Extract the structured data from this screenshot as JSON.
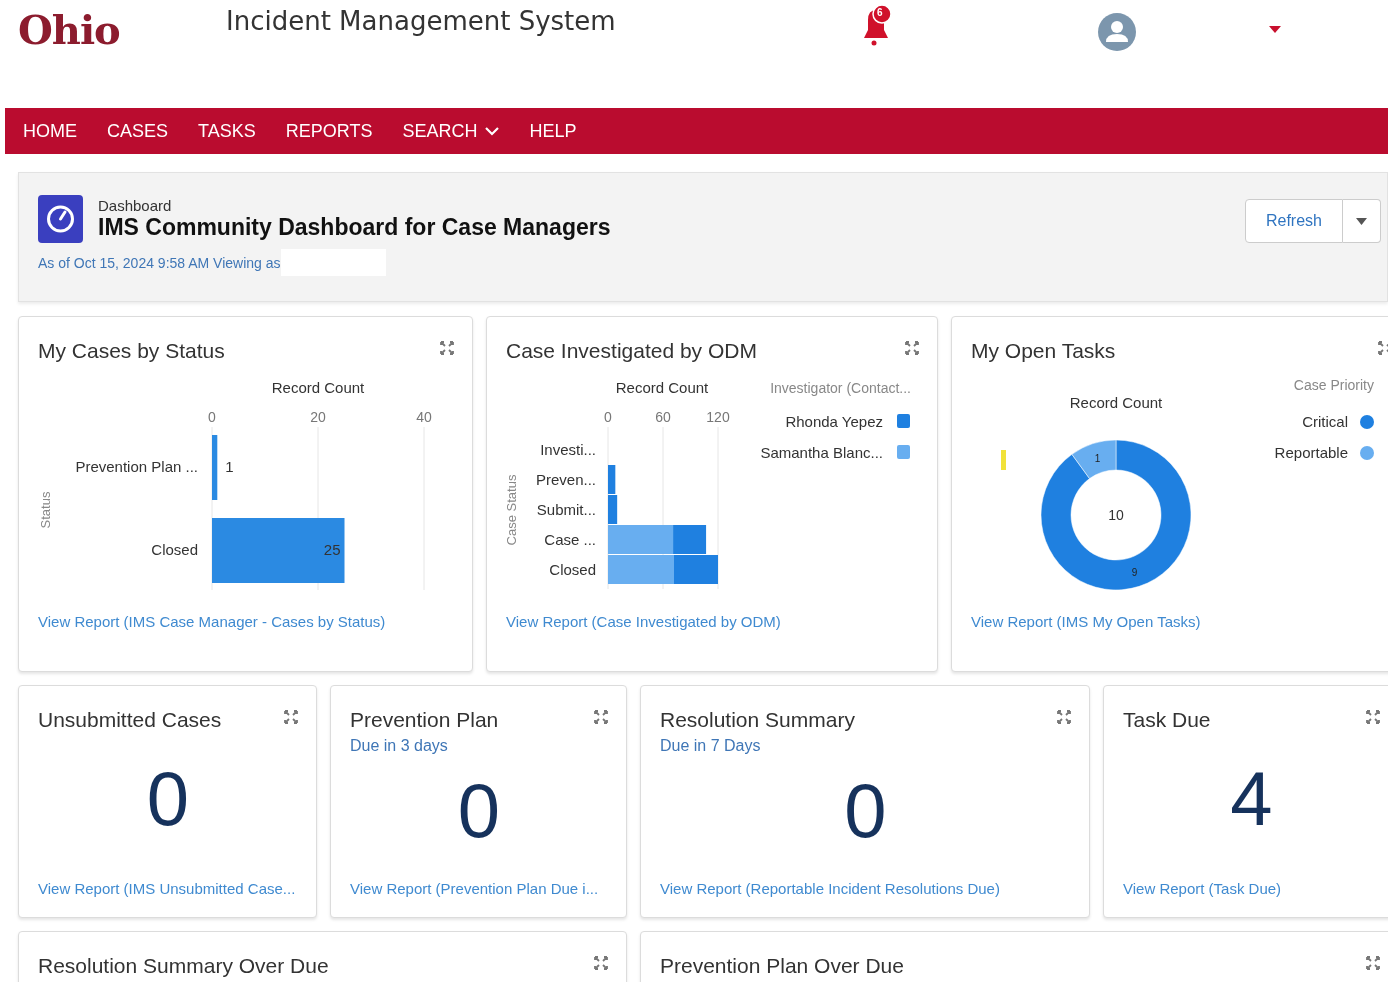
{
  "header": {
    "logo": "Ohio",
    "title": "Incident Management System",
    "notification_count": "6"
  },
  "nav": [
    {
      "label": "HOME",
      "has_menu": false
    },
    {
      "label": "CASES",
      "has_menu": false
    },
    {
      "label": "TASKS",
      "has_menu": false
    },
    {
      "label": "REPORTS",
      "has_menu": false
    },
    {
      "label": "SEARCH",
      "has_menu": true
    },
    {
      "label": "HELP",
      "has_menu": false
    }
  ],
  "dashboard": {
    "kicker": "Dashboard",
    "title": "IMS Community Dashboard for Case Managers",
    "as_of": "As of Oct 15, 2024 9:58 AM Viewing as",
    "refresh": "Refresh"
  },
  "rows": [
    {
      "cards": [
        {
          "kind": "bar",
          "title": "My Cases by Status",
          "link": "View Report (IMS Case Manager - Cases by Status)",
          "chart_data": {
            "type": "bar",
            "orientation": "horizontal",
            "xlabel": "Record Count",
            "ylabel": "Status",
            "categories": [
              "Prevention Plan ...",
              "Closed"
            ],
            "values": [
              1,
              25
            ],
            "xlim": [
              0,
              40
            ],
            "xticks": [
              0,
              20,
              40
            ],
            "data_labels": true
          }
        },
        {
          "kind": "stacked_bar",
          "title": "Case Investigated by ODM",
          "link": "View Report (Case Investigated by ODM)",
          "chart_data": {
            "type": "bar",
            "orientation": "horizontal",
            "stacked": true,
            "legend": {
              "title": "Investigator (Contact..."
            },
            "xlabel": "Record Count",
            "ylabel": "Case Status",
            "categories": [
              "Investi...",
              "Preven...",
              "Submit...",
              "Case ...",
              "Closed"
            ],
            "xlim": [
              0,
              120
            ],
            "xticks": [
              0,
              60,
              120
            ],
            "series": [
              {
                "name": "Rhonda Yepez",
                "color": "#1f80e0",
                "values": [
                  0,
                  8,
                  10,
                  36,
                  48
                ]
              },
              {
                "name": "Samantha Blanc...",
                "color": "#68aef0",
                "values": [
                  0,
                  0,
                  0,
                  71,
                  72
                ]
              }
            ]
          }
        },
        {
          "kind": "donut",
          "title": "My Open Tasks",
          "total": "10",
          "link": "View Report (IMS My Open Tasks)",
          "legend_items": [
            {
              "color": "#1f80e0"
            },
            {
              "color": "#68aef0"
            }
          ],
          "chart_data": {
            "type": "donut",
            "title": "Record Count",
            "data_labels": true,
            "legend": {
              "title": "Case Priority"
            },
            "categories": [
              "Critical",
              "Reportable"
            ],
            "values": [
              9,
              1
            ]
          }
        }
      ]
    },
    {
      "cards": [
        {
          "kind": "metric",
          "title": "Unsubmitted Cases",
          "value": "0",
          "link": "View Report (IMS Unsubmitted Case..."
        },
        {
          "kind": "metric",
          "title": "Prevention Plan",
          "subtitle": "Due in 3 days",
          "value": "0",
          "link": "View Report (Prevention Plan Due i..."
        },
        {
          "kind": "metric",
          "title": "Resolution Summary",
          "subtitle": "Due in 7 Days",
          "value": "0",
          "link": "View Report (Reportable Incident Resolutions Due)"
        },
        {
          "kind": "metric",
          "title": "Task Due",
          "value": "4",
          "link": "View Report (Task Due)"
        }
      ]
    },
    {
      "cards": [
        {
          "kind": "empty",
          "title": "Resolution Summary Over Due"
        },
        {
          "kind": "empty",
          "title": "Prevention Plan Over Due"
        }
      ]
    }
  ]
}
